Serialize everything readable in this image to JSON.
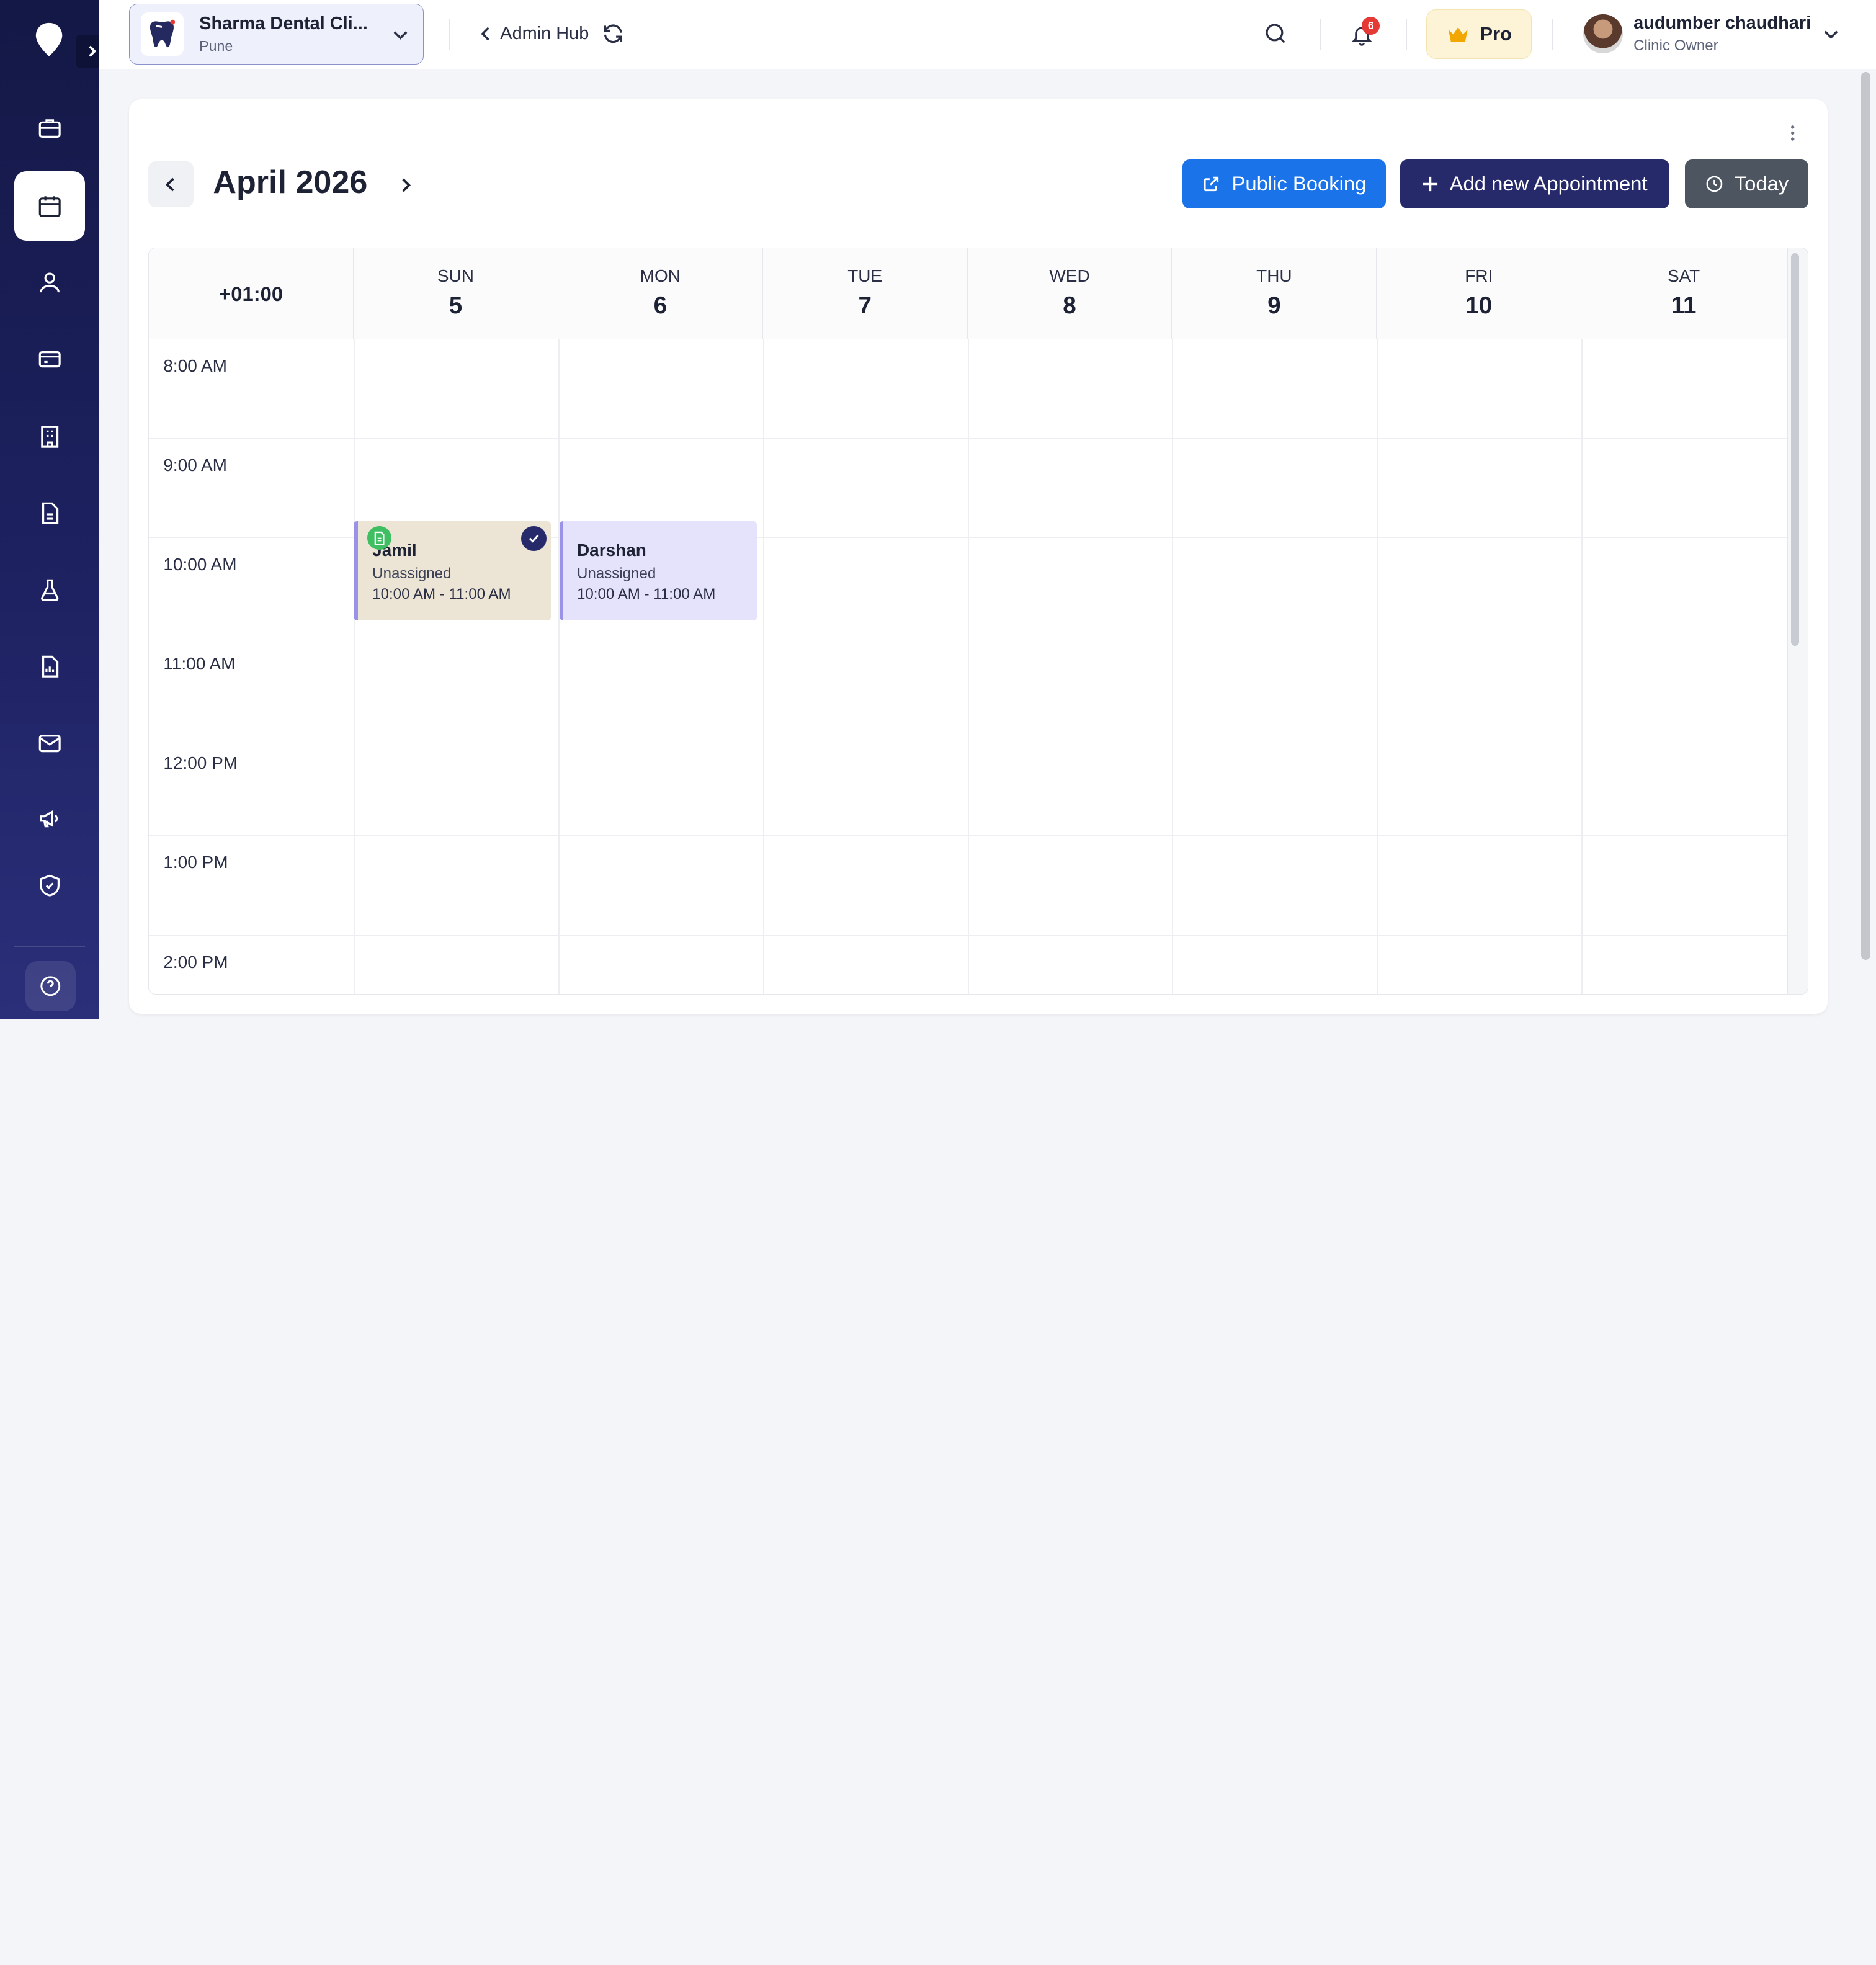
{
  "clinic": {
    "name": "Sharma Dental Cli...",
    "city": "Pune"
  },
  "header": {
    "admin_hub": "Admin Hub",
    "notification_count": "6",
    "pro_label": "Pro"
  },
  "user": {
    "name": "audumber chaudhari",
    "role": "Clinic Owner"
  },
  "calendar": {
    "title": "April 2026",
    "timezone": "+01:00",
    "buttons": {
      "public_booking": "Public Booking",
      "add_appointment": "Add new Appointment",
      "today": "Today"
    },
    "days": [
      {
        "name": "SUN",
        "num": "5"
      },
      {
        "name": "MON",
        "num": "6"
      },
      {
        "name": "TUE",
        "num": "7"
      },
      {
        "name": "WED",
        "num": "8"
      },
      {
        "name": "THU",
        "num": "9"
      },
      {
        "name": "FRI",
        "num": "10"
      },
      {
        "name": "SAT",
        "num": "11"
      }
    ],
    "hours": [
      "8:00 AM",
      "9:00 AM",
      "10:00 AM",
      "11:00 AM",
      "12:00 PM",
      "1:00 PM",
      "2:00 PM"
    ],
    "appointments": [
      {
        "name": "Jamil",
        "status": "Unassigned",
        "time": "10:00 AM - 11:00 AM"
      },
      {
        "name": "Darshan",
        "status": "Unassigned",
        "time": "10:00 AM - 11:00 AM"
      }
    ]
  },
  "colors": {
    "sidebar": "#1d2160",
    "primary": "#262a6b",
    "public_booking": "#1a73e8",
    "today": "#4d5560"
  },
  "icons": {
    "sidebar": [
      "briefcase-icon",
      "calendar-icon",
      "user-icon",
      "card-icon",
      "building-icon",
      "document-icon",
      "flask-icon",
      "report-icon",
      "mail-icon",
      "megaphone-icon",
      "shield-icon",
      "help-icon"
    ]
  }
}
